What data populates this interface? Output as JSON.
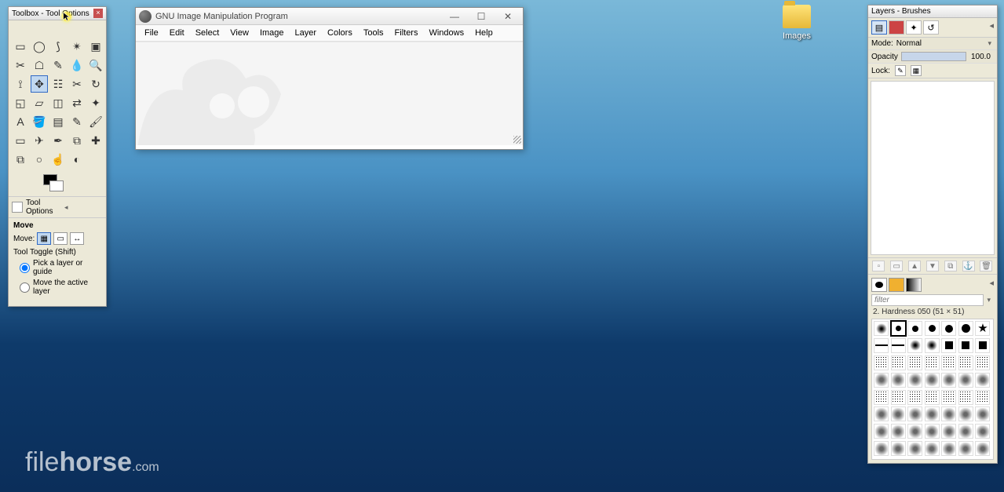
{
  "desktop": {
    "folder_label": "Images"
  },
  "toolbox": {
    "title": "Toolbox - Tool Options",
    "tools": [
      "rect-select",
      "ellipse-select",
      "free-select",
      "fuzzy-select",
      "by-color-select",
      "scissors",
      "foreground-select",
      "paths",
      "color-picker",
      "zoom",
      "measure",
      "move",
      "align",
      "crop",
      "rotate",
      "scale",
      "shear",
      "perspective",
      "flip",
      "cage",
      "text",
      "bucket-fill",
      "blend",
      "pencil",
      "paintbrush",
      "eraser",
      "airbrush",
      "ink",
      "clone",
      "heal",
      "perspective-clone",
      "blur",
      "smudge",
      "dodge-burn",
      ""
    ],
    "options_title": "Tool Options",
    "opt_section": "Move",
    "move_label": "Move:",
    "toggle_label": "Tool Toggle  (Shift)",
    "radio1": "Pick a layer or guide",
    "radio2": "Move the active layer"
  },
  "mainwin": {
    "title": "GNU Image Manipulation Program",
    "menus": [
      "File",
      "Edit",
      "Select",
      "View",
      "Image",
      "Layer",
      "Colors",
      "Tools",
      "Filters",
      "Windows",
      "Help"
    ]
  },
  "rdock": {
    "title": "Layers - Brushes",
    "mode_label": "Mode:",
    "mode_value": "Normal",
    "opacity_label": "Opacity",
    "opacity_value": "100.0",
    "lock_label": "Lock:",
    "filter_placeholder": "filter",
    "brush_label": "2. Hardness 050 (51 × 51)"
  },
  "watermark": {
    "a": "file",
    "b": "horse",
    "c": ".com"
  }
}
